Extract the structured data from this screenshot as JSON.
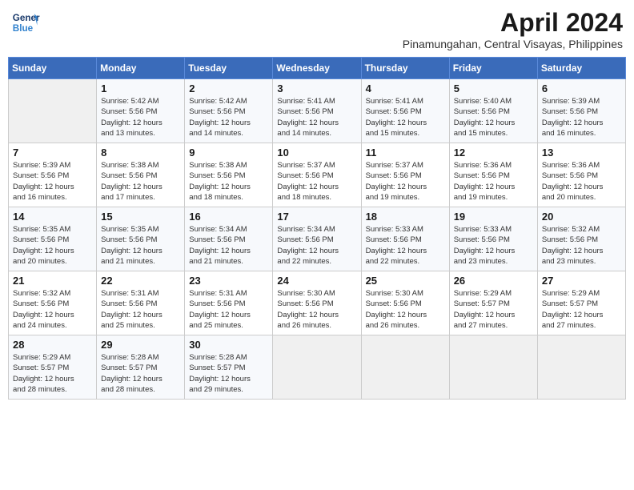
{
  "header": {
    "logo_line1": "General",
    "logo_line2": "Blue",
    "title": "April 2024",
    "subtitle": "Pinamungahan, Central Visayas, Philippines"
  },
  "calendar": {
    "days_of_week": [
      "Sunday",
      "Monday",
      "Tuesday",
      "Wednesday",
      "Thursday",
      "Friday",
      "Saturday"
    ],
    "weeks": [
      [
        {
          "day": "",
          "info": ""
        },
        {
          "day": "1",
          "info": "Sunrise: 5:42 AM\nSunset: 5:56 PM\nDaylight: 12 hours\nand 13 minutes."
        },
        {
          "day": "2",
          "info": "Sunrise: 5:42 AM\nSunset: 5:56 PM\nDaylight: 12 hours\nand 14 minutes."
        },
        {
          "day": "3",
          "info": "Sunrise: 5:41 AM\nSunset: 5:56 PM\nDaylight: 12 hours\nand 14 minutes."
        },
        {
          "day": "4",
          "info": "Sunrise: 5:41 AM\nSunset: 5:56 PM\nDaylight: 12 hours\nand 15 minutes."
        },
        {
          "day": "5",
          "info": "Sunrise: 5:40 AM\nSunset: 5:56 PM\nDaylight: 12 hours\nand 15 minutes."
        },
        {
          "day": "6",
          "info": "Sunrise: 5:39 AM\nSunset: 5:56 PM\nDaylight: 12 hours\nand 16 minutes."
        }
      ],
      [
        {
          "day": "7",
          "info": "Sunrise: 5:39 AM\nSunset: 5:56 PM\nDaylight: 12 hours\nand 16 minutes."
        },
        {
          "day": "8",
          "info": "Sunrise: 5:38 AM\nSunset: 5:56 PM\nDaylight: 12 hours\nand 17 minutes."
        },
        {
          "day": "9",
          "info": "Sunrise: 5:38 AM\nSunset: 5:56 PM\nDaylight: 12 hours\nand 18 minutes."
        },
        {
          "day": "10",
          "info": "Sunrise: 5:37 AM\nSunset: 5:56 PM\nDaylight: 12 hours\nand 18 minutes."
        },
        {
          "day": "11",
          "info": "Sunrise: 5:37 AM\nSunset: 5:56 PM\nDaylight: 12 hours\nand 19 minutes."
        },
        {
          "day": "12",
          "info": "Sunrise: 5:36 AM\nSunset: 5:56 PM\nDaylight: 12 hours\nand 19 minutes."
        },
        {
          "day": "13",
          "info": "Sunrise: 5:36 AM\nSunset: 5:56 PM\nDaylight: 12 hours\nand 20 minutes."
        }
      ],
      [
        {
          "day": "14",
          "info": "Sunrise: 5:35 AM\nSunset: 5:56 PM\nDaylight: 12 hours\nand 20 minutes."
        },
        {
          "day": "15",
          "info": "Sunrise: 5:35 AM\nSunset: 5:56 PM\nDaylight: 12 hours\nand 21 minutes."
        },
        {
          "day": "16",
          "info": "Sunrise: 5:34 AM\nSunset: 5:56 PM\nDaylight: 12 hours\nand 21 minutes."
        },
        {
          "day": "17",
          "info": "Sunrise: 5:34 AM\nSunset: 5:56 PM\nDaylight: 12 hours\nand 22 minutes."
        },
        {
          "day": "18",
          "info": "Sunrise: 5:33 AM\nSunset: 5:56 PM\nDaylight: 12 hours\nand 22 minutes."
        },
        {
          "day": "19",
          "info": "Sunrise: 5:33 AM\nSunset: 5:56 PM\nDaylight: 12 hours\nand 23 minutes."
        },
        {
          "day": "20",
          "info": "Sunrise: 5:32 AM\nSunset: 5:56 PM\nDaylight: 12 hours\nand 23 minutes."
        }
      ],
      [
        {
          "day": "21",
          "info": "Sunrise: 5:32 AM\nSunset: 5:56 PM\nDaylight: 12 hours\nand 24 minutes."
        },
        {
          "day": "22",
          "info": "Sunrise: 5:31 AM\nSunset: 5:56 PM\nDaylight: 12 hours\nand 25 minutes."
        },
        {
          "day": "23",
          "info": "Sunrise: 5:31 AM\nSunset: 5:56 PM\nDaylight: 12 hours\nand 25 minutes."
        },
        {
          "day": "24",
          "info": "Sunrise: 5:30 AM\nSunset: 5:56 PM\nDaylight: 12 hours\nand 26 minutes."
        },
        {
          "day": "25",
          "info": "Sunrise: 5:30 AM\nSunset: 5:56 PM\nDaylight: 12 hours\nand 26 minutes."
        },
        {
          "day": "26",
          "info": "Sunrise: 5:29 AM\nSunset: 5:57 PM\nDaylight: 12 hours\nand 27 minutes."
        },
        {
          "day": "27",
          "info": "Sunrise: 5:29 AM\nSunset: 5:57 PM\nDaylight: 12 hours\nand 27 minutes."
        }
      ],
      [
        {
          "day": "28",
          "info": "Sunrise: 5:29 AM\nSunset: 5:57 PM\nDaylight: 12 hours\nand 28 minutes."
        },
        {
          "day": "29",
          "info": "Sunrise: 5:28 AM\nSunset: 5:57 PM\nDaylight: 12 hours\nand 28 minutes."
        },
        {
          "day": "30",
          "info": "Sunrise: 5:28 AM\nSunset: 5:57 PM\nDaylight: 12 hours\nand 29 minutes."
        },
        {
          "day": "",
          "info": ""
        },
        {
          "day": "",
          "info": ""
        },
        {
          "day": "",
          "info": ""
        },
        {
          "day": "",
          "info": ""
        }
      ]
    ]
  }
}
